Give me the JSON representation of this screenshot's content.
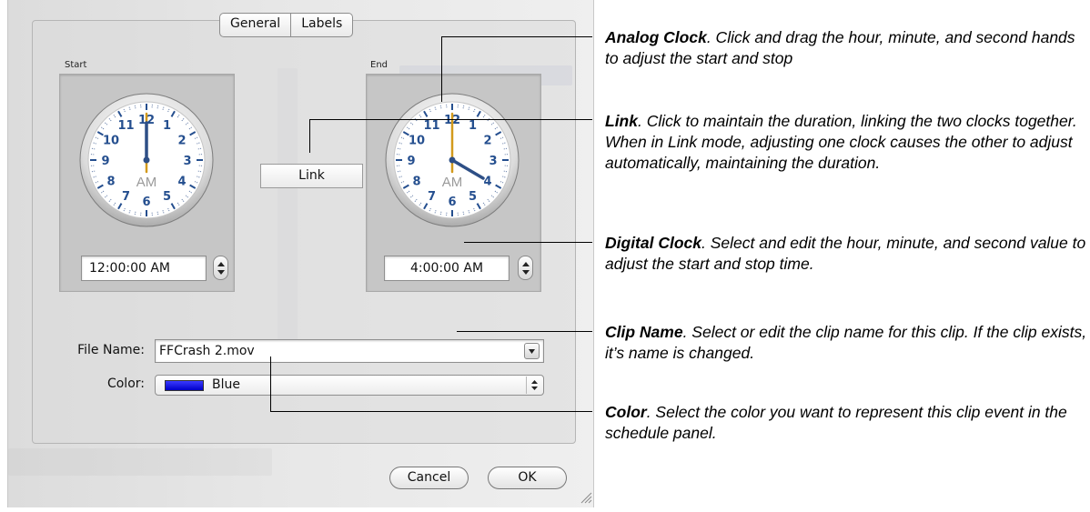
{
  "dialog": {
    "tabs": [
      {
        "label": "General"
      },
      {
        "label": "Labels"
      }
    ],
    "start": {
      "label": "Start",
      "time": "12:00:00 AM",
      "clock": {
        "hour": 12,
        "minute": 0,
        "second": 0,
        "ampm": "AM"
      }
    },
    "end": {
      "label": "End",
      "time": "4:00:00 AM",
      "clock": {
        "hour": 4,
        "minute": 0,
        "second": 0,
        "ampm": "AM"
      }
    },
    "link_button": "Link",
    "file_name": {
      "label": "File Name:",
      "value": "FFCrash 2.mov"
    },
    "color": {
      "label": "Color:",
      "value": "Blue",
      "swatch": "#1010e0"
    },
    "cancel_button": "Cancel",
    "ok_button": "OK"
  },
  "annotations": [
    {
      "title": "Analog Clock",
      "text": ". Click and drag the hour, minute, and second hands to adjust the start and stop"
    },
    {
      "title": "Link",
      "text": ". Click to maintain the duration, linking the two clocks together. When in Link mode, adjusting one clock causes the other to adjust automatically, maintaining the duration."
    },
    {
      "title": "Digital Clock",
      "text": ". Select and edit the hour, minute, and second value to adjust the start and stop time."
    },
    {
      "title": "Clip Name",
      "text": ". Select or edit the clip name for this clip. If the clip exists, it’s name is changed."
    },
    {
      "title": "Color",
      "text": ". Select the color you want to represent this clip event in the schedule panel."
    }
  ],
  "colors": {
    "hour_hand": "#2e4f86",
    "minute_hand": "#d39a1c",
    "clock_numbers": "#254f8f"
  }
}
